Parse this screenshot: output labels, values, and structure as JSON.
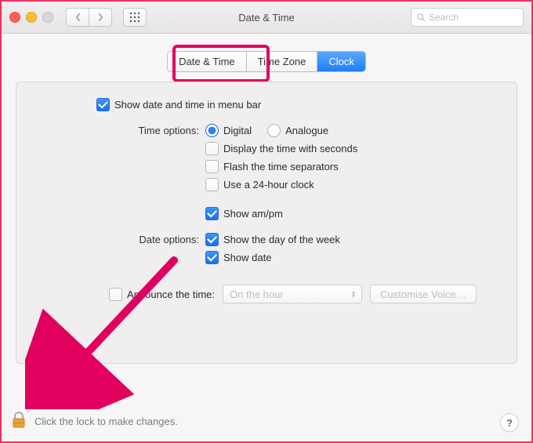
{
  "window": {
    "title": "Date & Time"
  },
  "search": {
    "placeholder": "Search"
  },
  "tabs": {
    "date_time": "Date & Time",
    "time_zone": "Time Zone",
    "clock": "Clock",
    "selected": "clock"
  },
  "options": {
    "menubar": "Show date and time in menu bar",
    "time_label": "Time options:",
    "digital": "Digital",
    "analogue": "Analogue",
    "seconds": "Display the time with seconds",
    "flash": "Flash the time separators",
    "hour24": "Use a 24-hour clock",
    "ampm": "Show am/pm",
    "date_label": "Date options:",
    "dayofweek": "Show the day of the week",
    "showdate": "Show date",
    "announce": "Announce the time:",
    "announce_interval": "On the hour",
    "customise": "Customise Voice…"
  },
  "lock": {
    "text": "Click the lock to make changes."
  },
  "help": {
    "label": "?"
  }
}
